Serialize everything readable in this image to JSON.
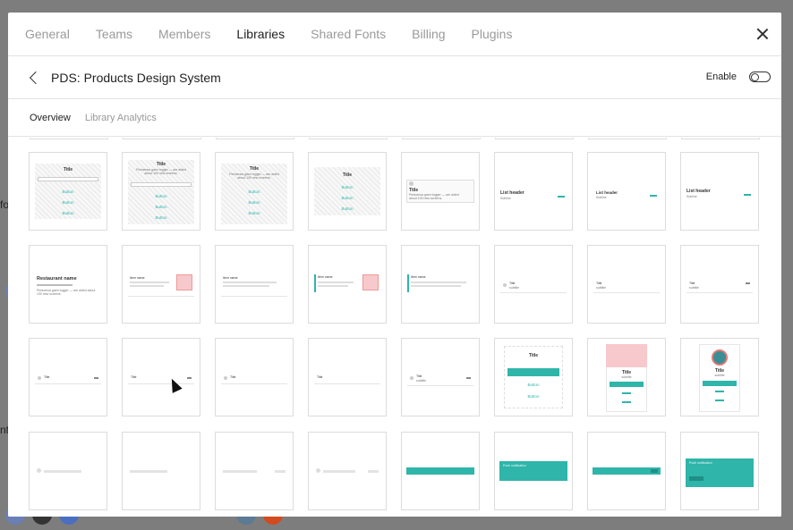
{
  "background": {
    "left_text": [
      "fo",
      "nt"
    ],
    "avatar_colors": [
      "#6a7fb5",
      "#333333",
      "#4a6fc1",
      "#5a7a95",
      "#d24a1e"
    ]
  },
  "tabs": [
    {
      "label": "General",
      "active": false
    },
    {
      "label": "Teams",
      "active": false
    },
    {
      "label": "Members",
      "active": false
    },
    {
      "label": "Libraries",
      "active": true
    },
    {
      "label": "Shared Fonts",
      "active": false
    },
    {
      "label": "Billing",
      "active": false
    },
    {
      "label": "Plugins",
      "active": false
    }
  ],
  "library": {
    "title": "PDS: Products Design System",
    "enable_label": "Enable"
  },
  "subtabs": [
    {
      "label": "Overview",
      "active": true
    },
    {
      "label": "Library Analytics",
      "active": false
    }
  ],
  "thumbnails": {
    "dialog_title": "Title",
    "dialog_body": "Pertuensa gaen togger — are aided about 100 new screens.",
    "button_label": "Button",
    "list_header": "List header",
    "list_sub": "Subline",
    "restaurant_name": "Restaurant name",
    "item_name": "Item name",
    "row_title": "Title",
    "row_sub": "subtitle",
    "toast_text": "Push notification"
  },
  "accent_color": "#2fb5aa"
}
